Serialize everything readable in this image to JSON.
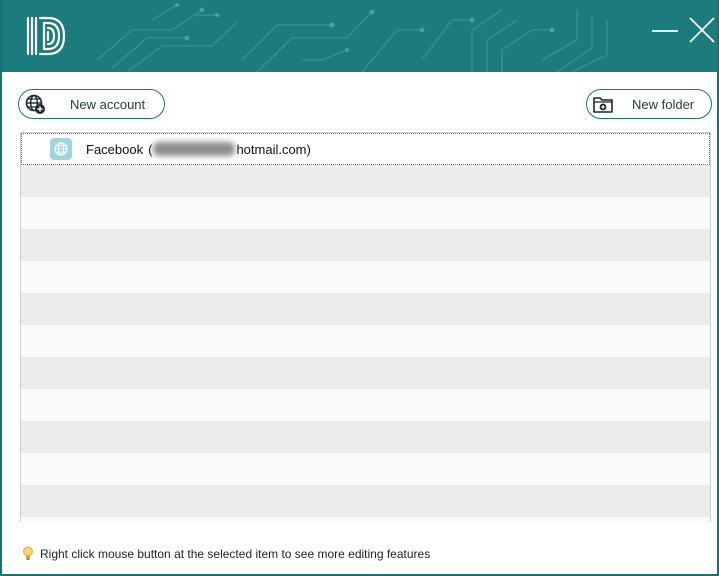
{
  "window": {
    "logo_text": "ID",
    "minimize_icon": "minimize-icon",
    "close_icon": "close-icon",
    "accent_color": "#1c7b7c"
  },
  "toolbar": {
    "new_account_label": "New account",
    "new_account_icon": "globe-plus-icon",
    "new_folder_label": "New folder",
    "new_folder_icon": "folder-plus-icon"
  },
  "accounts": [
    {
      "name": "Facebook",
      "email_prefix": "(",
      "email_suffix": "hotmail.com)",
      "email_redacted": true,
      "icon": "globe-icon",
      "selected": true
    }
  ],
  "footer": {
    "hint_icon": "lightbulb-icon",
    "hint": "Right click mouse button at the selected item to see more editing features"
  }
}
